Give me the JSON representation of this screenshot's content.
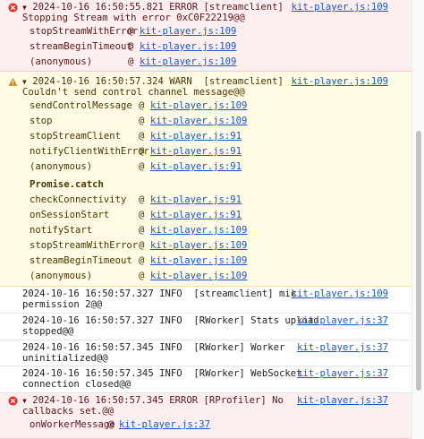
{
  "messages": [
    {
      "level": "error",
      "collapsed": false,
      "header": "2024-10-16 16:50:55.821 ERROR [streamclient]",
      "text_line2": "Stopping Stream with error 0xC0F22219@@",
      "source": "kit-player.js:109",
      "frames": [
        {
          "fn": "stopStreamWithError",
          "at": "@",
          "link": "kit-player.js:109"
        },
        {
          "fn": "streamBeginTimeout",
          "at": "@",
          "link": "kit-player.js:109"
        },
        {
          "fn": "(anonymous)",
          "at": "@",
          "link": "kit-player.js:109"
        }
      ]
    },
    {
      "level": "warn",
      "header": "2024-10-16 16:50:57.324 WARN  [streamclient]",
      "text_line2": "Couldn't send control channel message@@",
      "source": "kit-player.js:109",
      "frames": [
        {
          "fn": "sendControlMessage",
          "at": "@",
          "link": "kit-player.js:109"
        },
        {
          "fn": "stop",
          "at": "@",
          "link": "kit-player.js:109"
        },
        {
          "fn": "stopStreamClient",
          "at": "@",
          "link": "kit-player.js:91"
        },
        {
          "fn": "notifyClientWithError",
          "at": "@",
          "link": "kit-player.js:91"
        },
        {
          "fn": "(anonymous)",
          "at": "@",
          "link": "kit-player.js:91"
        }
      ],
      "async_label": "Promise.catch",
      "async_frames": [
        {
          "fn": "checkConnectivity",
          "at": "@",
          "link": "kit-player.js:91"
        },
        {
          "fn": "onSessionStart",
          "at": "@",
          "link": "kit-player.js:91"
        },
        {
          "fn": "notifyStart",
          "at": "@",
          "link": "kit-player.js:109"
        },
        {
          "fn": "stopStreamWithError",
          "at": "@",
          "link": "kit-player.js:109"
        },
        {
          "fn": "streamBeginTimeout",
          "at": "@",
          "link": "kit-player.js:109"
        },
        {
          "fn": "(anonymous)",
          "at": "@",
          "link": "kit-player.js:109"
        }
      ]
    },
    {
      "level": "info",
      "line1": "2024-10-16 16:50:57.327 INFO  [streamclient] mic",
      "line2": "permission 2@@",
      "source": "kit-player.js:109"
    },
    {
      "level": "info",
      "line1": "2024-10-16 16:50:57.327 INFO  [RWorker] Stats upload",
      "line2": "stopped@@",
      "source": "kit-player.js:37"
    },
    {
      "level": "info",
      "line1": "2024-10-16 16:50:57.345 INFO  [RWorker] Worker",
      "line2": "uninitialized@@",
      "source": "kit-player.js:37"
    },
    {
      "level": "info",
      "line1": "2024-10-16 16:50:57.345 INFO  [RWorker] WebSocket",
      "line2": "connection closed@@",
      "source": "kit-player.js:37"
    },
    {
      "level": "error",
      "header": "2024-10-16 16:50:57.345 ERROR [RProfiler] No",
      "text_line2": "callbacks set.@@",
      "source": "kit-player.js:37",
      "frames": [
        {
          "fn": "onWorkerMessage",
          "at": "@",
          "link": "kit-player.js:37"
        }
      ]
    }
  ],
  "caret_glyph": "▼",
  "colors": {
    "error_bg": "#fdeff0",
    "warn_bg": "#fffbe4",
    "error_icon": "#e0342b",
    "warn_icon": "#e08a00",
    "link": "#1a56c9"
  },
  "icons": {
    "error": "error-circle-icon",
    "warn": "warning-triangle-icon",
    "expand": "caret-down-icon"
  }
}
